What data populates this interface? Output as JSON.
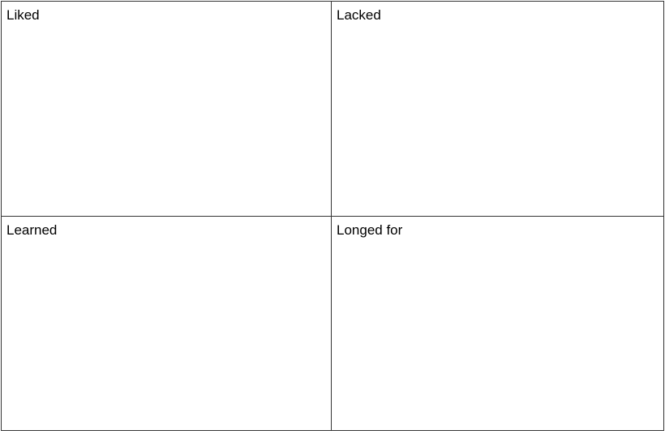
{
  "quadrants": {
    "liked": "Liked",
    "lacked": "Lacked",
    "learned": "Learned",
    "longed_for": "Longed for"
  }
}
